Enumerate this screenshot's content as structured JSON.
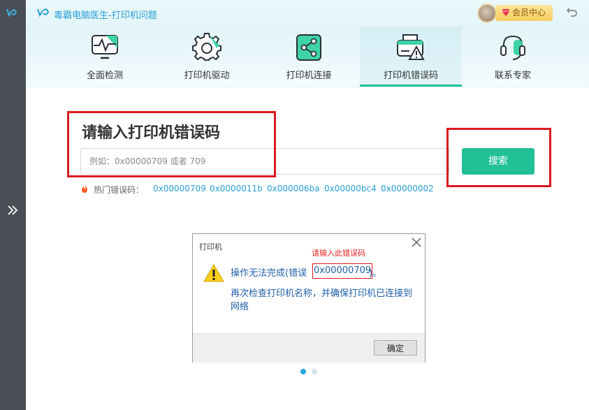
{
  "app": {
    "title": "毒霸电脑医生-打印机问题",
    "vip_label": "会员中心"
  },
  "tabs": [
    {
      "label": "全面检测",
      "icon": "monitor-pulse-icon"
    },
    {
      "label": "打印机驱动",
      "icon": "gear-icon"
    },
    {
      "label": "打印机连接",
      "icon": "share-icon"
    },
    {
      "label": "打印机错误码",
      "icon": "printer-warning-icon",
      "active": true
    },
    {
      "label": "联系专家",
      "icon": "headset-icon"
    }
  ],
  "main": {
    "heading": "请输入打印机错误码",
    "search_placeholder": "例如：0x00000709 或者 709",
    "search_button": "搜索",
    "hot_label": "热门错误码：",
    "hot_codes": [
      "0x00000709",
      "0x0000011b",
      "0x000006ba",
      "0x00000bc4",
      "0x00000002"
    ]
  },
  "dialog": {
    "title": "打印机",
    "hint": "请输入此错误码",
    "message_prefix": "操作无法完成(错误",
    "error_code": "0x00000709",
    "message_suffix": ")。",
    "message_line2": "再次检查打印机名称，并确保打印机已连接到网络",
    "ok_button": "确定"
  },
  "carousel": {
    "dots": 2,
    "active_index": 0
  },
  "colors": {
    "accent_green": "#21c097",
    "link_blue": "#2a9fd4",
    "highlight_red": "#d9191f"
  }
}
